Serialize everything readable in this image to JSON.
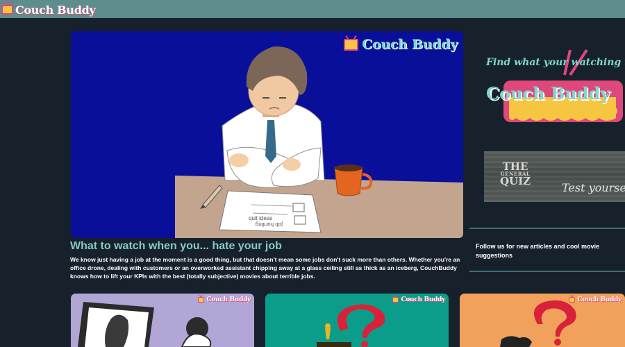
{
  "header": {
    "logo_text": "Couch Buddy"
  },
  "hero": {
    "brand_text": "Couch Buddy",
    "paper_text_1": "quit ideas",
    "paper_text_2": "job hunting"
  },
  "article": {
    "title": "What to watch when you... hate your job",
    "description": "We know just having a job at the moment is a good thing, but that doesn't mean some jobs don't suck more than others. Whether you're an office drone, dealing with customers or an overworked assistant chipping away at a glass ceiling still as thick as an iceberg, CouchBuddy knows how to lift your KPIs with the best (totally subjective) movies about terrible jobs."
  },
  "sidebar": {
    "promo_tagline": "Find what your watching tonight",
    "promo_name": "Couch Buddy",
    "quiz_title_top": "THE",
    "quiz_title_mid": "GENERAL",
    "quiz_title_bottom": "QUIZ",
    "quiz_subtitle": "Test yourself",
    "follow_text": "Follow us for new articles and cool movie suggestions"
  },
  "cards": [
    {
      "brand_text": "Couch Buddy",
      "bg_color": "#b1a6d6"
    },
    {
      "brand_text": "Couch Buddy",
      "bg_color": "#0c9c8a"
    },
    {
      "brand_text": "Couch Buddy",
      "bg_color": "#f1a15c"
    }
  ],
  "colors": {
    "page_bg": "#17212b",
    "header_bg": "#5e8d8e",
    "accent_teal": "#7ed6cf",
    "title_teal": "#86c9c9",
    "brand_pink": "#e0477a",
    "brand_yellow": "#f6c542"
  }
}
